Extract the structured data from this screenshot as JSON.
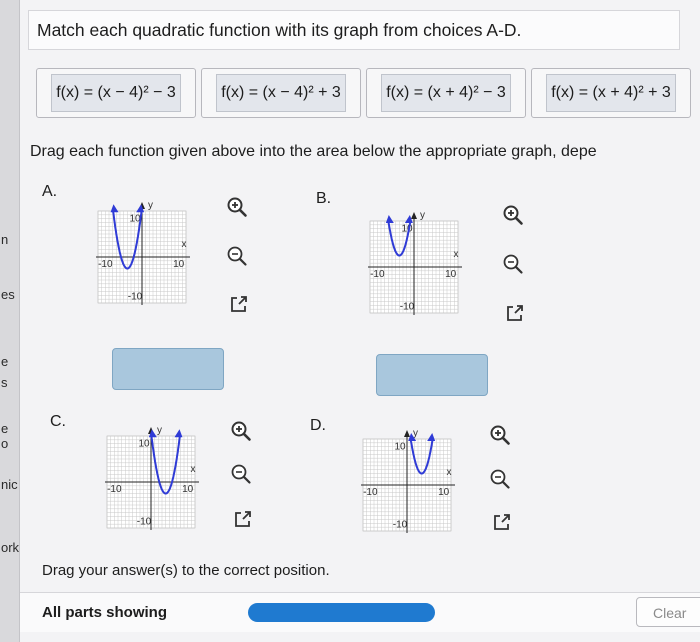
{
  "left_strip": {
    "fragments": [
      "n",
      "es",
      "e",
      "s",
      "e o",
      "nic",
      "ork"
    ]
  },
  "question": {
    "title": "Match each quadratic function with its graph from choices A-D.",
    "chips": [
      "f(x) = (x − 4)² − 3",
      "f(x) = (x − 4)² + 3",
      "f(x) = (x + 4)² − 3",
      "f(x) = (x + 4)² + 3"
    ],
    "instruction": "Drag each function given above into the area below the appropriate graph, depe",
    "graphs": [
      {
        "label": "A.",
        "vertex": [
          -4,
          -3
        ]
      },
      {
        "label": "B.",
        "vertex": [
          -4,
          3
        ]
      },
      {
        "label": "C.",
        "vertex": [
          4,
          -3
        ]
      },
      {
        "label": "D.",
        "vertex": [
          4,
          3
        ]
      }
    ],
    "axis_labels": {
      "x": "x",
      "y": "y",
      "min": "-10",
      "max": "10"
    },
    "drag_prompt": "Drag your answer(s) to the correct position."
  },
  "footer": {
    "parts_label": "All parts showing",
    "clear_label": "Clear"
  },
  "icons": [
    "zoom-in-icon",
    "zoom-out-icon",
    "external-window-icon",
    "drag-handle-icon"
  ],
  "colors": {
    "curve": "#2f3bd6",
    "dropzone": "#a9c7dd",
    "progress": "#1f7ad0",
    "chip_inner": "#e3e6ec"
  }
}
